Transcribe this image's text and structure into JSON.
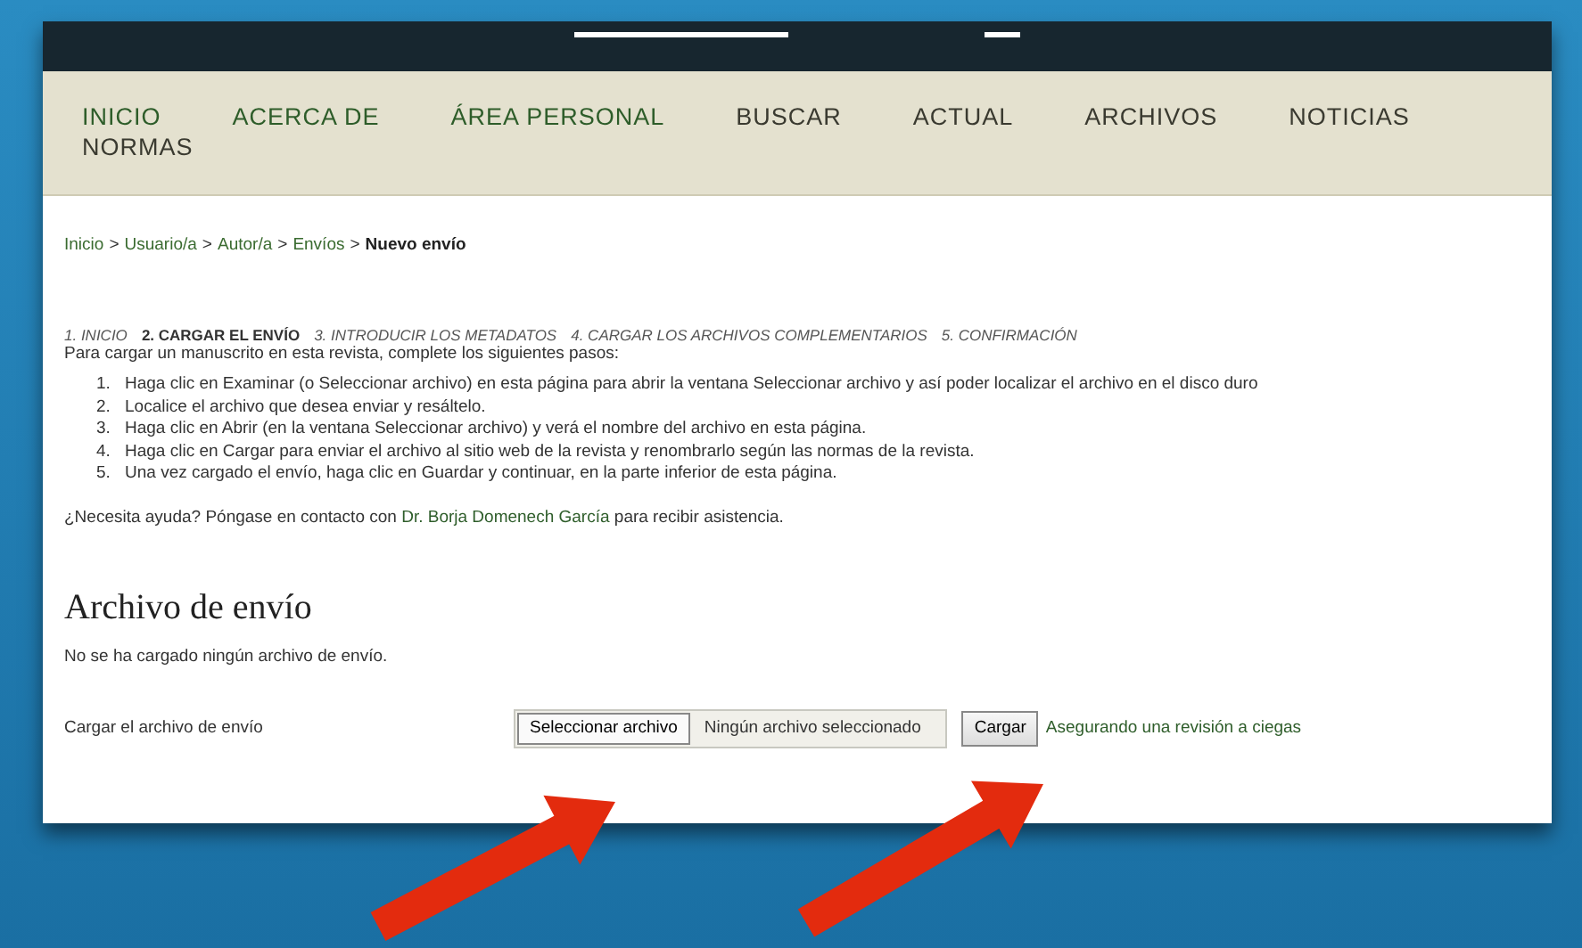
{
  "nav": {
    "items": [
      {
        "label": "INICIO"
      },
      {
        "label": "ACERCA DE"
      },
      {
        "label": "ÁREA PERSONAL"
      },
      {
        "label": "BUSCAR"
      },
      {
        "label": "ACTUAL"
      },
      {
        "label": "ARCHIVOS"
      },
      {
        "label": "NOTICIAS"
      },
      {
        "label": "NORMAS"
      }
    ]
  },
  "breadcrumb": [
    {
      "kind": "link",
      "label": "Inicio",
      "current": false
    },
    {
      "kind": "separator",
      "label": ">"
    },
    {
      "kind": "link",
      "label": "Usuario/a",
      "current": false
    },
    {
      "kind": "separator",
      "label": ">"
    },
    {
      "kind": "link",
      "label": "Autor/a",
      "current": false
    },
    {
      "kind": "separator",
      "label": ">"
    },
    {
      "kind": "link",
      "label": "Envíos",
      "current": false
    },
    {
      "kind": "separator",
      "label": ">"
    },
    {
      "kind": "link",
      "label": "Nuevo envío",
      "current": true
    }
  ],
  "steps": [
    {
      "label": "1. INICIO",
      "selected": false
    },
    {
      "label": "2. CARGAR EL ENVÍO",
      "selected": true
    },
    {
      "label": "3. INTRODUCIR LOS METADATOS",
      "selected": false
    },
    {
      "label": "4. CARGAR LOS ARCHIVOS COMPLEMENTARIOS",
      "selected": false
    },
    {
      "label": "5. CONFIRMACIÓN",
      "selected": false
    }
  ],
  "intro": "Para cargar un manuscrito en esta revista, complete los siguientes pasos:",
  "instructions": [
    {
      "number": "1.",
      "text": "Haga clic en Examinar (o Seleccionar archivo) en esta página para abrir la ventana Seleccionar archivo y así poder localizar el archivo en el disco duro"
    },
    {
      "number": "2.",
      "text": "Localice el archivo que desea enviar y resáltelo."
    },
    {
      "number": "3.",
      "text": "Haga clic en Abrir (en la ventana Seleccionar archivo) y verá el nombre del archivo en esta página."
    },
    {
      "number": "4.",
      "text": "Haga clic en Cargar para enviar el archivo al sitio web de la revista y renombrarlo según las normas de la revista."
    },
    {
      "number": "5.",
      "text": "Una vez cargado el envío, haga clic en Guardar y continuar, en la parte inferior de esta página."
    }
  ],
  "help": {
    "before": "¿Necesita ayuda? Póngase en contacto con",
    "link": "Dr. Borja Domenech García",
    "after": "para recibir asistencia."
  },
  "file_section": {
    "title": "Archivo de envío",
    "status": "No se ha cargado ningún archivo de envío.",
    "upload_label": "Cargar el archivo de envío",
    "choose_button": "Seleccionar archivo",
    "no_file": "Ningún archivo seleccionado",
    "upload_button": "Cargar",
    "blind_link": "Asegurando una revisión a ciegas"
  }
}
